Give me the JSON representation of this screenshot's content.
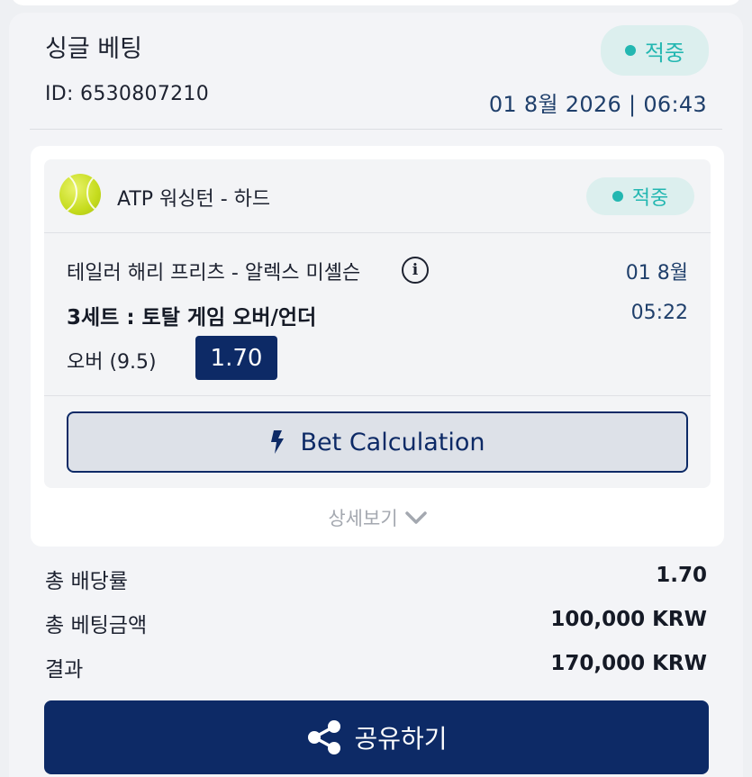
{
  "bet": {
    "title": "싱글 베팅",
    "id": "ID: 6530807210",
    "status": "적중",
    "datetime": "01 8월 2026 | 06:43"
  },
  "event": {
    "league": "ATP 워싱턴 - 하드",
    "status": "적중",
    "match": "테일러 해리 프리츠 - 알렉스 미셸슨",
    "date": "01 8월",
    "time": "05:22",
    "market": "3세트 : 토탈 게임 오버/언더",
    "selection": "오버 (9.5)",
    "odds": "1.70",
    "calc_label": "Bet Calculation",
    "details_label": "상세보기"
  },
  "summary": [
    {
      "label": "총 배당률",
      "value": "1.70"
    },
    {
      "label": "총 베팅금액",
      "value": "100,000 KRW"
    },
    {
      "label": "결과",
      "value": "170,000 KRW"
    }
  ],
  "share_label": "공유하기",
  "colors": {
    "primary": "#0d2a66",
    "status": "#23b7b1",
    "status_bg": "#dcefee",
    "date_text": "#1f3f6b"
  },
  "icons": {
    "sport": "tennis-ball-icon",
    "info": "info-icon",
    "calc": "lightning-icon",
    "details": "chevron-down-icon",
    "share": "share-icon"
  }
}
